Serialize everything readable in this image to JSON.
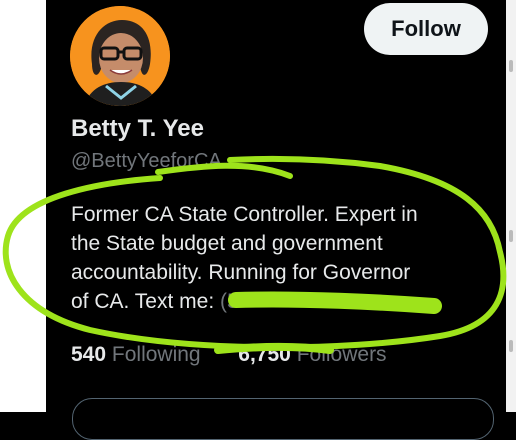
{
  "profile": {
    "display_name": "Betty T. Yee",
    "handle": "@BettyYeeforCA",
    "follow_label": "Follow",
    "bio_line1": "Former CA State Controller. Expert in",
    "bio_line2": "the State budget and government",
    "bio_line3": "accountability. Running for Governor",
    "bio_line4": "of CA. Text me:",
    "bio_phone_partial": "(5",
    "following_count": "540",
    "following_label": "Following",
    "followers_count": "6,750",
    "followers_label": "Followers"
  },
  "colors": {
    "background": "#000000",
    "marker": "#9ee31b",
    "muted_text": "#71767b",
    "avatar_bg": "#f7931e"
  }
}
